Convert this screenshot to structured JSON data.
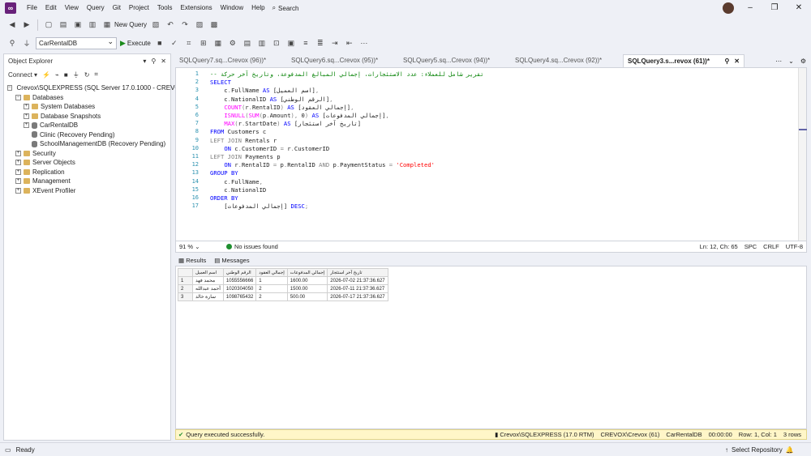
{
  "menu": [
    "File",
    "Edit",
    "View",
    "Query",
    "Git",
    "Project",
    "Tools",
    "Extensions",
    "Window",
    "Help"
  ],
  "search_label": "Search",
  "toolbar": {
    "new_query": "New Query",
    "database": "CarRentalDB",
    "execute": "Execute"
  },
  "object_explorer": {
    "title": "Object Explorer",
    "connect": "Connect",
    "server": "Crevox\\SQLEXPRESS (SQL Server 17.0.1000 - CREVOX\\",
    "nodes": [
      "Databases",
      "System Databases",
      "Database Snapshots",
      "CarRentalDB",
      "Clinic (Recovery Pending)",
      "SchoolManagementDB (Recovery Pending)",
      "Security",
      "Server Objects",
      "Replication",
      "Management",
      "XEvent Profiler"
    ]
  },
  "tabs": [
    "SQLQuery7.sq...Crevox (96))*",
    "SQLQuery6.sq...Crevox (95))*",
    "SQLQuery5.sq...Crevox (94))*",
    "SQLQuery4.sq...Crevox (92))*",
    "SQLQuery3.s...revox (61))*"
  ],
  "code_lines": [
    {
      "n": "1",
      "html": "<span class='cm'>-- تقرير شامل للعملاء: عدد الاستئجارات، إجمالي المبالغ المدفوعة، وتاريخ آخر حركة</span>"
    },
    {
      "n": "2",
      "html": "<span class='kw'>SELECT</span>"
    },
    {
      "n": "3",
      "html": "    c<span class='gr'>.</span>FullName <span class='kw'>AS</span> [اسم العميل]<span class='gr'>,</span>"
    },
    {
      "n": "4",
      "html": "    c<span class='gr'>.</span>NationalID <span class='kw'>AS</span> [الرقم الوطني]<span class='gr'>,</span>"
    },
    {
      "n": "5",
      "html": "    <span class='fn'>COUNT</span><span class='gr'>(</span>r<span class='gr'>.</span>RentalID<span class='gr'>)</span> <span class='kw'>AS</span> [إجمالي العقود]<span class='gr'>,</span>"
    },
    {
      "n": "6",
      "html": "    <span class='fn'>ISNULL</span><span class='gr'>(</span><span class='fn'>SUM</span><span class='gr'>(</span>p<span class='gr'>.</span>Amount<span class='gr'>),</span> 0<span class='gr'>)</span> <span class='kw'>AS</span> [إجمالي المدفوعات]<span class='gr'>,</span>"
    },
    {
      "n": "7",
      "html": "    <span class='fn'>MAX</span><span class='gr'>(</span>r<span class='gr'>.</span>StartDate<span class='gr'>)</span> <span class='kw'>AS</span> [تاريخ آخر استئجار]"
    },
    {
      "n": "8",
      "html": "<span class='kw'>FROM</span> Customers c"
    },
    {
      "n": "9",
      "html": "<span class='gr'>LEFT JOIN</span> Rentals r"
    },
    {
      "n": "10",
      "html": "    <span class='kw'>ON</span> c<span class='gr'>.</span>CustomerID <span class='gr'>=</span> r<span class='gr'>.</span>CustomerID"
    },
    {
      "n": "11",
      "html": "<span class='gr'>LEFT JOIN</span> Payments p"
    },
    {
      "n": "12",
      "html": "    <span class='kw'>ON</span> r<span class='gr'>.</span>RentalID <span class='gr'>=</span> p<span class='gr'>.</span>RentalID <span class='gr'>AND</span> p<span class='gr'>.</span>PaymentStatus <span class='gr'>=</span> <span class='st'>'Completed'</span>"
    },
    {
      "n": "13",
      "html": "<span class='kw'>GROUP BY</span>"
    },
    {
      "n": "14",
      "html": "    c<span class='gr'>.</span>FullName<span class='gr'>,</span>"
    },
    {
      "n": "15",
      "html": "    c<span class='gr'>.</span>NationalID"
    },
    {
      "n": "16",
      "html": "<span class='kw'>ORDER BY</span>"
    },
    {
      "n": "17",
      "html": "    [إجمالي المدفوعات] <span class='kw'>DESC</span><span class='gr'>;</span>"
    }
  ],
  "editor_status": {
    "zoom": "91 %",
    "issues": "No issues found",
    "pos": "Ln: 12, Ch: 65",
    "spc": "SPC",
    "crlf": "CRLF",
    "enc": "UTF-8"
  },
  "result_tabs": {
    "results": "Results",
    "messages": "Messages"
  },
  "results": {
    "headers": [
      "اسم العميل",
      "الرقم الوطني",
      "إجمالي العقود",
      "إجمالي المدفوعات",
      "تاريخ آخر استئجار"
    ],
    "rows": [
      [
        "1",
        "محمد فهد",
        "1055556666",
        "1",
        "1600.00",
        "2026-07-02 21:37:36.627"
      ],
      [
        "2",
        "أحمد عبدالله",
        "1020304050",
        "2",
        "1500.00",
        "2026-07-11 21:37:36.627"
      ],
      [
        "3",
        "سارة خالد",
        "1098765432",
        "2",
        "500.00",
        "2026-07-17 21:37:36.627"
      ]
    ]
  },
  "query_status": {
    "message": "Query executed successfully.",
    "server": "Crevox\\SQLEXPRESS (17.0 RTM)",
    "user": "CREVOX\\Crevox (61)",
    "db": "CarRentalDB",
    "time": "00:00:00",
    "rowcol": "Row: 1, Col: 1",
    "rows": "3 rows"
  },
  "statusbar": {
    "ready": "Ready",
    "repo": "Select Repository"
  }
}
